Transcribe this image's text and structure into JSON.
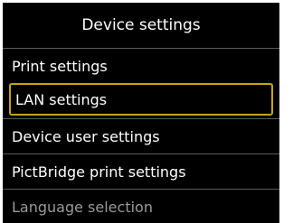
{
  "header": {
    "title": "Device settings"
  },
  "menu": {
    "items": [
      {
        "label": "Print settings"
      },
      {
        "label": "LAN settings"
      },
      {
        "label": "Device user settings"
      },
      {
        "label": "PictBridge print settings"
      },
      {
        "label": "Language selection"
      }
    ]
  },
  "colors": {
    "background": "#000000",
    "text": "#ffffff",
    "selection_border": "#c4a615",
    "divider": "#5a5a5a"
  }
}
